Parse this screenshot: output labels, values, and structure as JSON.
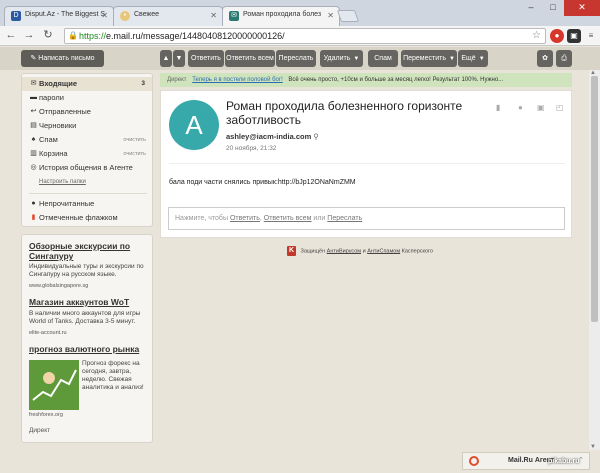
{
  "browser": {
    "tabs": [
      {
        "label": "Disput.Az - The Biggest S",
        "icon": "D",
        "icon_color": "#ffffff"
      },
      {
        "label": "Свежее",
        "icon": "•",
        "icon_color": "#c8902a"
      },
      {
        "label": "Роман проходила болез",
        "icon": "✉",
        "icon_color": "#2a7a72"
      }
    ],
    "url_scheme": "https://",
    "url_rest": "e.mail.ru/message/14480408120000000126/",
    "window": {
      "minimize": "–",
      "maximize": "□",
      "close": "✕"
    }
  },
  "toolbar": {
    "compose": "Написать письмо",
    "reply": "Ответить",
    "reply_all": "Ответить всем",
    "forward": "Переслать",
    "delete": "Удалить",
    "spam": "Спам",
    "move": "Переместить",
    "more": "Ещё"
  },
  "sidebar": {
    "inbox": {
      "label": "Входящие",
      "count": "3"
    },
    "passwords": "пароли",
    "sent": "Отправленные",
    "drafts": "Черновики",
    "spam": {
      "label": "Спам",
      "action": "очистить"
    },
    "trash": {
      "label": "Корзина",
      "action": "очистить"
    },
    "agent_history": "История общения в Агенте",
    "settings_link": "Настроить папки",
    "unread": "Непрочитанные",
    "flagged": "Отмеченные флажком"
  },
  "ads": [
    {
      "title": "Обзорные экскурсии по Сингапуру",
      "text": "Индивидуальные туры и экскурсии по Сингапуру на русском языке.",
      "url": "www.globalsingapore.sg"
    },
    {
      "title": "Магазин аккаунтов WoT",
      "text": "В наличии много аккаунтов для игры World of Tanks. Доставка 3-5 минут.",
      "url": "elite-account.ru"
    },
    {
      "title": "прогноз валютного рынка",
      "text": "Прогноз форекс на сегодня, завтра, неделю. Свежая аналитика и анализ!",
      "url": "freshforex.org"
    }
  ],
  "direct_label": "Директ",
  "promo": {
    "label": "Директ",
    "link": "Теперь я в постели половой бог!",
    "text": "Всё очень просто, +10см и больше за месяц легко! Результат 100%. Нужно..."
  },
  "message": {
    "avatar_letter": "A",
    "subject": "Роман проходила болезненного горизонте заботливость",
    "sender": "ashley@iacm-india.com",
    "date": "20 ноября, 21:32",
    "body": "бала поди части снялись привык:http://bJp12ONaNmZMM",
    "reply_prefix": "Нажмите, чтобы",
    "reply_link1": "Ответить",
    "reply_link2": "Ответить всем",
    "reply_or": "или",
    "reply_link3": "Переслать"
  },
  "kaspersky": {
    "prefix": "Защищён",
    "antivirus": "АнтиВирусом",
    "and": "и",
    "antispam": "АнтиСпамом",
    "suffix": "Касперского"
  },
  "agent": {
    "label": "Mail.Ru Агент"
  },
  "watermark": "pikabu.ru"
}
